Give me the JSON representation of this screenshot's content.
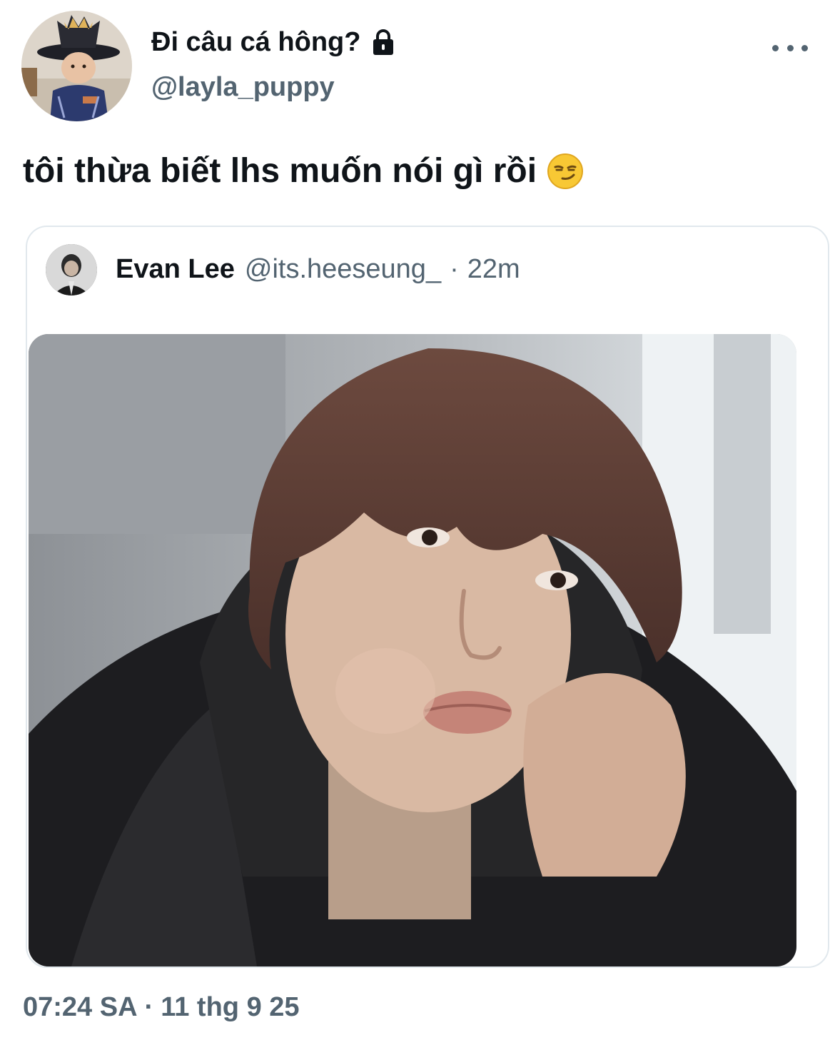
{
  "author": {
    "display_name": "Đi câu cá hông?",
    "handle": "@layla_puppy",
    "avatar_icon": "profile-photo",
    "protected_icon": "lock-icon"
  },
  "tweet": {
    "text": "tôi thừa biết lhs muốn nói gì rồi",
    "emoji": "smirking-face-icon"
  },
  "quoted_tweet": {
    "author_name": "Evan Lee",
    "author_handle": "@its.heeseung_",
    "separator": "·",
    "time_ago": "22m",
    "media_icon": "photo"
  },
  "footer": {
    "time": "07:24 SA",
    "separator": "·",
    "date": "11 thg 9 25"
  },
  "colors": {
    "text_primary": "#0f1419",
    "text_secondary": "#536471",
    "card_border": "#e1e8ed"
  }
}
